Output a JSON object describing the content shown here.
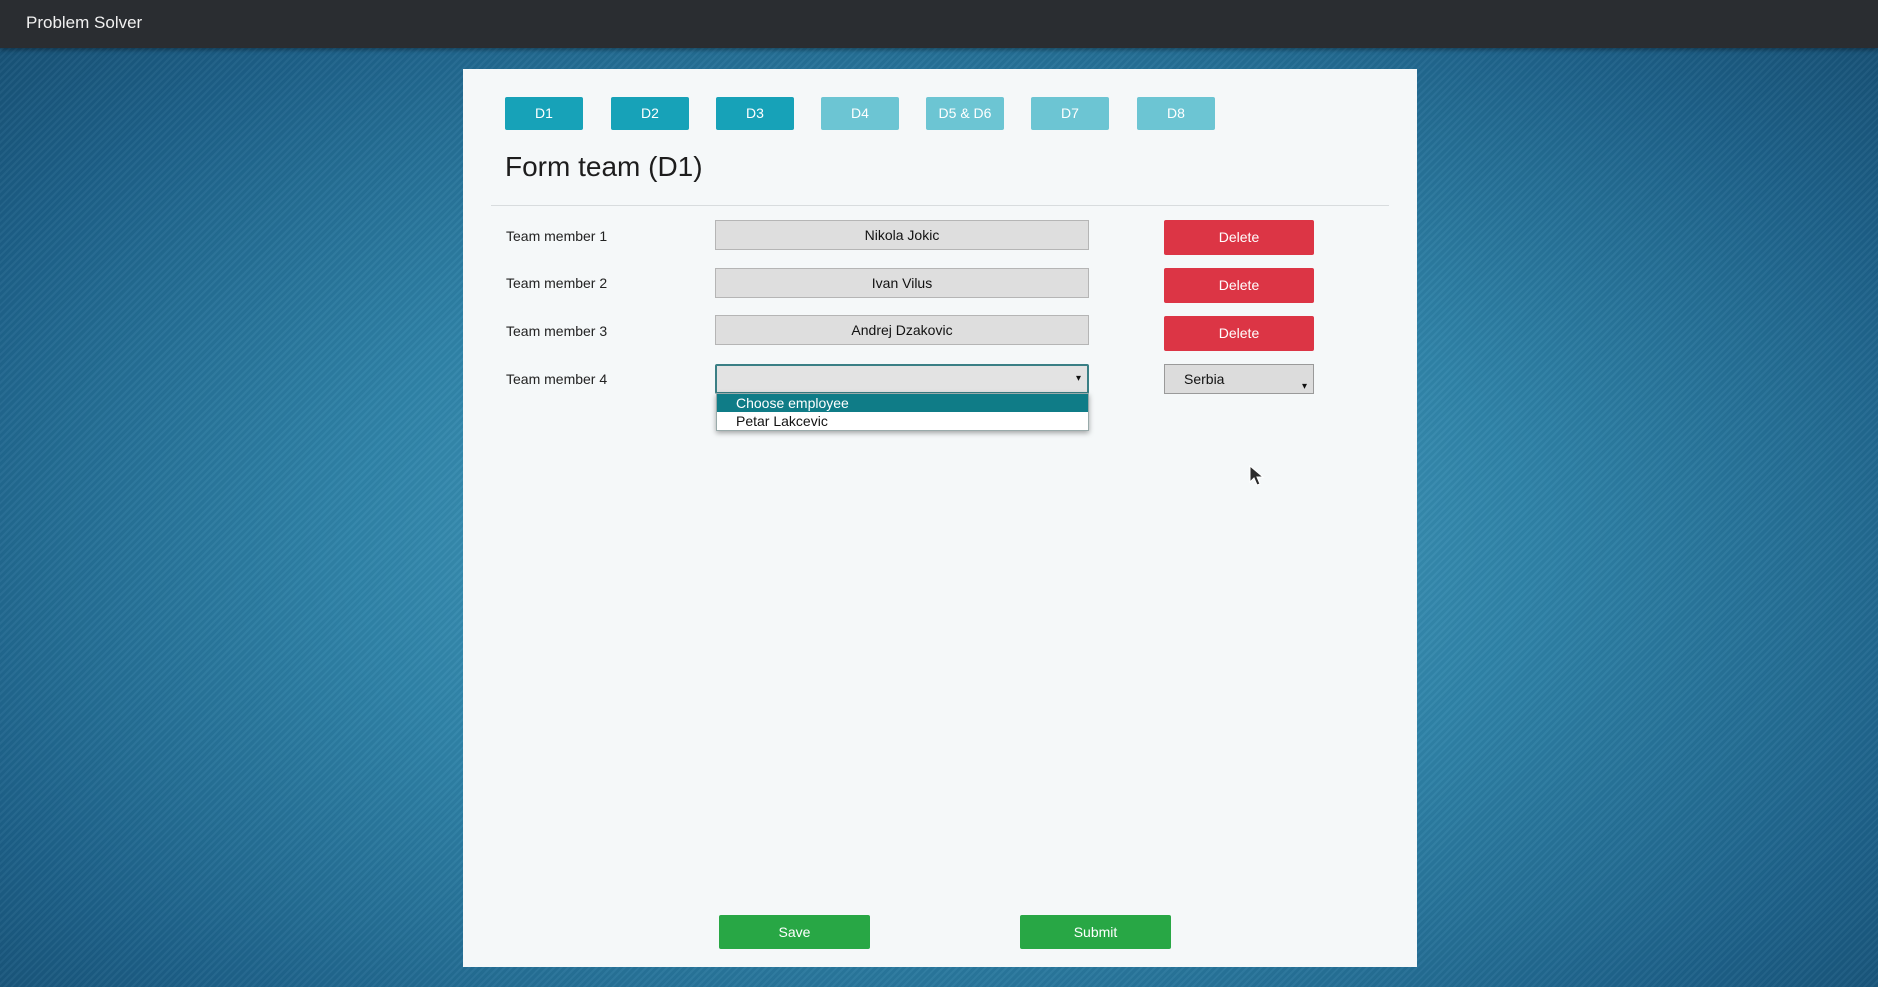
{
  "app": {
    "title": "Problem Solver"
  },
  "tabs": [
    {
      "label": "D1",
      "state": "active"
    },
    {
      "label": "D2",
      "state": "active"
    },
    {
      "label": "D3",
      "state": "active"
    },
    {
      "label": "D4",
      "state": "inactive"
    },
    {
      "label": "D5 & D6",
      "state": "inactive"
    },
    {
      "label": "D7",
      "state": "inactive"
    },
    {
      "label": "D8",
      "state": "inactive"
    }
  ],
  "page": {
    "title": "Form team (D1)"
  },
  "members": [
    {
      "label": "Team member 1",
      "value": "Nikola Jokic",
      "delete_label": "Delete"
    },
    {
      "label": "Team member 2",
      "value": "Ivan Vilus",
      "delete_label": "Delete"
    },
    {
      "label": "Team member 3",
      "value": "Andrej Dzakovic",
      "delete_label": "Delete"
    }
  ],
  "new_member": {
    "label": "Team member 4",
    "selected": "",
    "options": [
      "Choose employee",
      "Petar Lakcevic"
    ],
    "highlighted_option": "Choose employee",
    "country": "Serbia"
  },
  "actions": {
    "save": "Save",
    "submit": "Submit"
  },
  "colors": {
    "navbar": "#2a2d31",
    "tab_active": "#17a2b8",
    "tab_inactive": "#6cc5d3",
    "delete": "#dc3545",
    "success": "#28a745",
    "option_highlight": "#0f7c87"
  },
  "icons": {
    "dropdown_caret": "▾"
  }
}
